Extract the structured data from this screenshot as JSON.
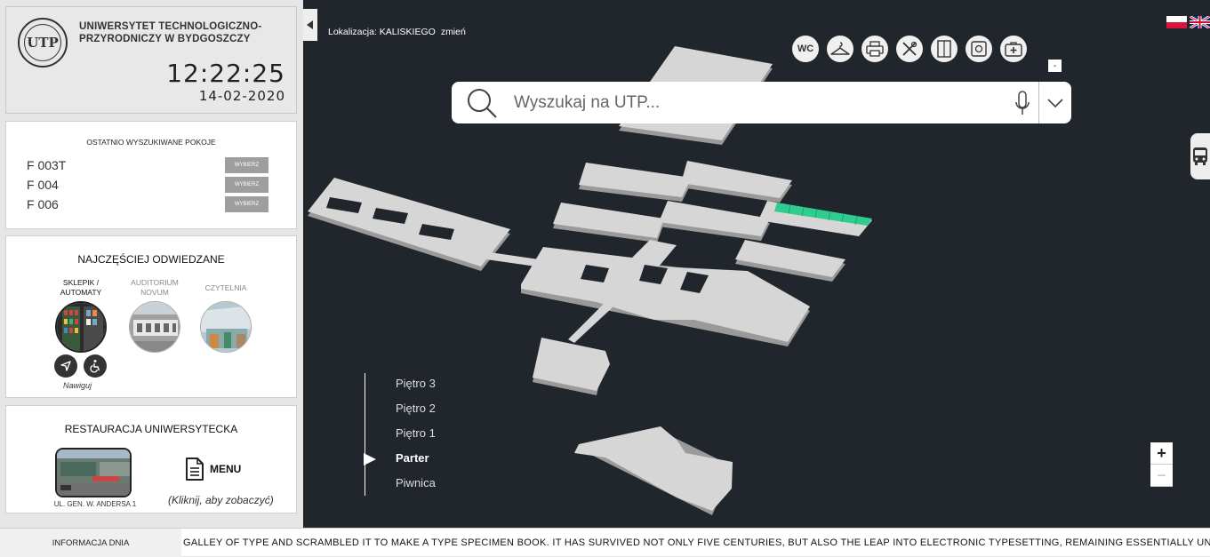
{
  "header": {
    "logo_text": "UTP",
    "university_name": "UNIWERSYTET TECHNOLOGICZNO-PRZYRODNICZY W BYDGOSZCZY",
    "time": "12:22:25",
    "date": "14-02-2020"
  },
  "recent": {
    "title": "OSTATNIO WYSZUKIWANE POKOJE",
    "items": [
      {
        "room": "F 003T",
        "button": "WYBIERZ"
      },
      {
        "room": "F 004",
        "button": "WYBIERZ"
      },
      {
        "room": "F 006",
        "button": "WYBIERZ"
      }
    ]
  },
  "popular": {
    "title": "NAJCZĘŚCIEJ ODWIEDZANE",
    "items": [
      {
        "label": "SKLEPIK / AUTOMATY"
      },
      {
        "label": "AUDITORIUM NOVUM"
      },
      {
        "label": "CZYTELNIA"
      }
    ],
    "navigate_label": "Nawiguj"
  },
  "restaurant": {
    "title": "RESTAURACJA UNIWERSYTECKA",
    "address": "UL. GEN. W. ANDERSA 1",
    "menu_label": "MENU",
    "menu_hint": "(Kliknij, aby zobaczyć)"
  },
  "map": {
    "location_label": "Lokalizacja: KALISKIEGO",
    "location_change": "zmień",
    "search_placeholder": "Wyszukaj na UTP...",
    "amenities": [
      "WC",
      "hanger-icon",
      "printer-icon",
      "food-icon",
      "elevator-icon",
      "atm-icon",
      "first-aid-icon"
    ],
    "amenity_wc_label": "WC",
    "collapse_label": "-",
    "floors": [
      {
        "label": "Piętro 3"
      },
      {
        "label": "Piętro 2"
      },
      {
        "label": "Piętro 1"
      },
      {
        "label": "Parter",
        "active": true
      },
      {
        "label": "Piwnica"
      }
    ],
    "zoom_in": "+",
    "zoom_out": "−",
    "highlight_color": "#2ecc8f",
    "building_color": "#d6d6d6"
  },
  "ticker": {
    "label": "INFORMACJA DNIA",
    "text": "GALLEY OF TYPE AND SCRAMBLED IT TO MAKE A TYPE SPECIMEN BOOK. IT HAS SURVIVED NOT ONLY FIVE CENTURIES, BUT ALSO THE LEAP INTO ELECTRONIC TYPESETTING, REMAINING ESSENTIALLY UNCHANGED."
  }
}
